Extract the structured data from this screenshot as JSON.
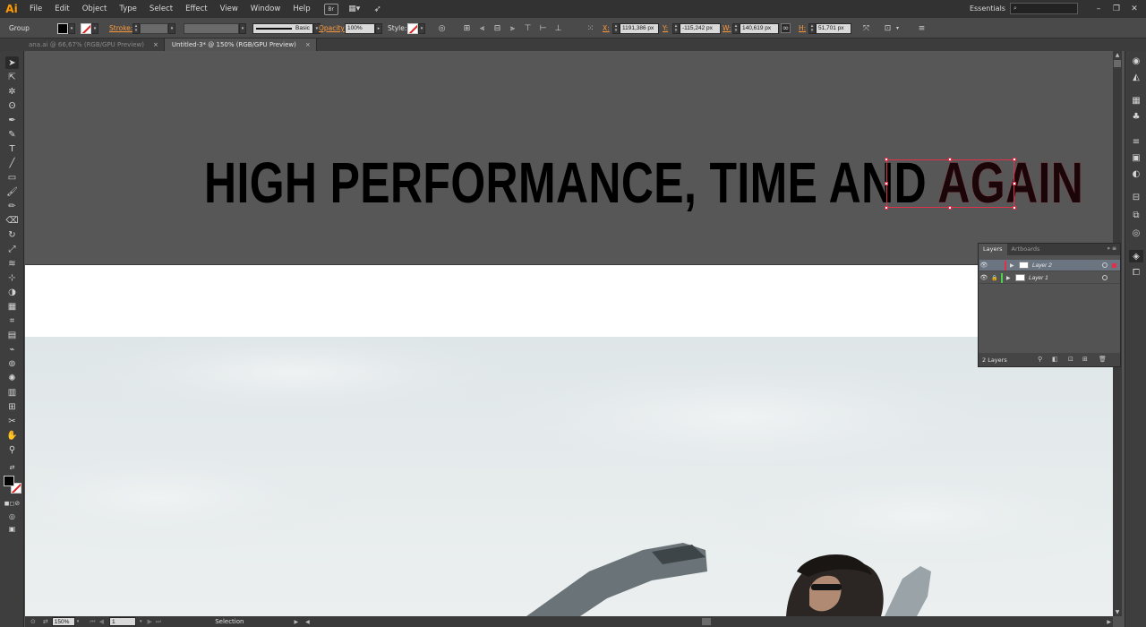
{
  "app": {
    "logo": "Ai"
  },
  "menu": [
    "File",
    "Edit",
    "Object",
    "Type",
    "Select",
    "Effect",
    "View",
    "Window",
    "Help"
  ],
  "menu_icons": {
    "bridge": "Br",
    "arrange": "▦▾"
  },
  "workspace": {
    "label": "Essentials",
    "chevron": "▾"
  },
  "control": {
    "selection_label": "Group",
    "stroke_label": "Stroke:",
    "stroke_style": "Basic",
    "opacity_label": "Opacity:",
    "opacity_value": "100%",
    "style_label": "Style:",
    "x_label": "X:",
    "x_value": "1191,386 px",
    "y_label": "Y:",
    "y_value": "-115,242 px",
    "w_label": "W:",
    "w_value": "140,619 px",
    "h_label": "H:",
    "h_value": "51,701 px"
  },
  "tabs": [
    {
      "label": "ana.ai @ 66,67% (RGB/GPU Preview)",
      "close": "×"
    },
    {
      "label": "Untitled-3* @ 150% (RGB/GPU Preview)",
      "close": "×"
    }
  ],
  "canvas": {
    "headline_main": "HIGH PERFORMANCE, TIME AND ",
    "headline_selected": "AGAIN"
  },
  "layers_panel": {
    "tabs": [
      "Layers",
      "Artboards"
    ],
    "layers": [
      {
        "name": "Layer 2",
        "color": "#e0304a",
        "selected": true
      },
      {
        "name": "Layer 1",
        "color": "#4cd04c",
        "selected": false
      }
    ],
    "count": "2 Layers"
  },
  "status": {
    "zoom": "150%",
    "artboard": "1",
    "tool": "Selection"
  },
  "colors": {
    "accent_orange": "#ff9a00",
    "selection_red": "#e0304a"
  }
}
